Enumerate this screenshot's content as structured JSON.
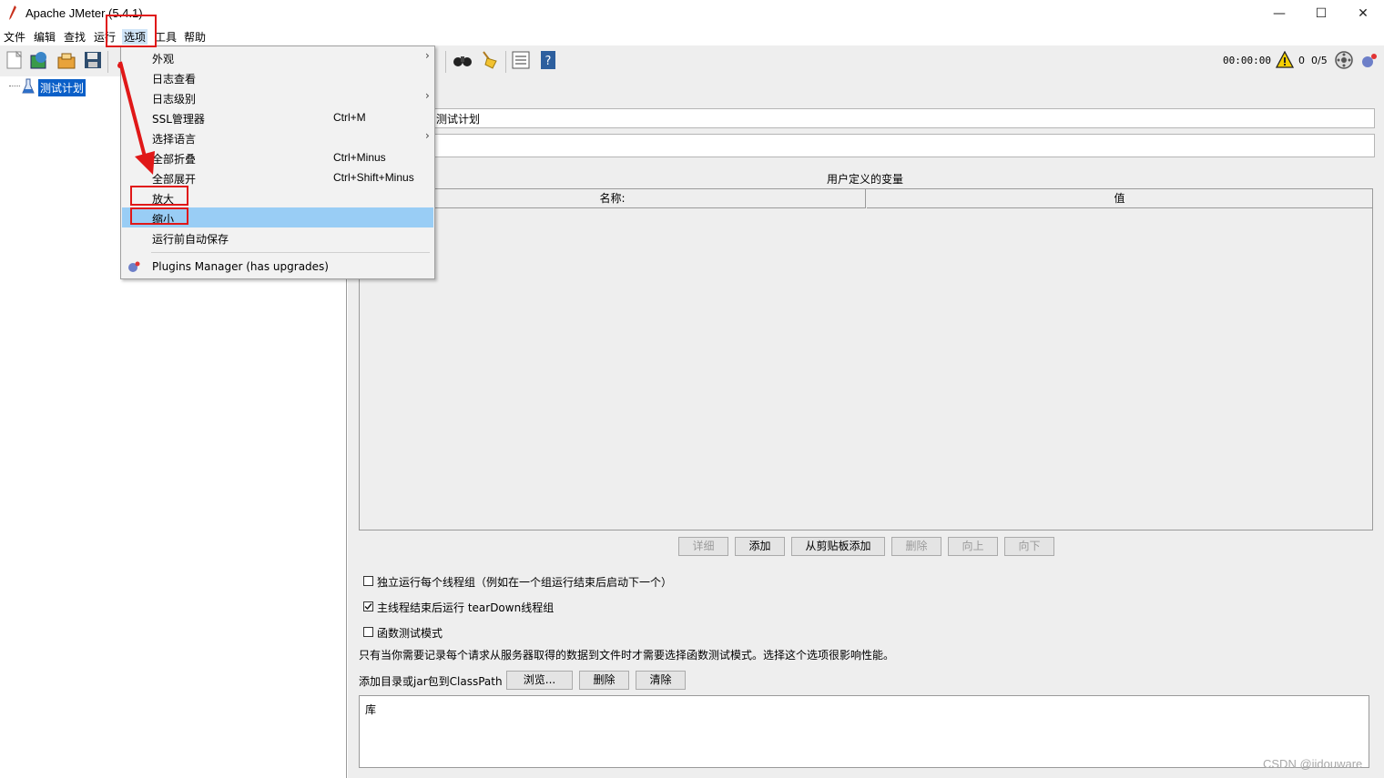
{
  "window": {
    "title": "Apache JMeter (5.4.1)",
    "minimize": "—",
    "maximize": "☐",
    "close": "✕"
  },
  "menubar": [
    "文件",
    "编辑",
    "查找",
    "运行",
    "选项",
    "工具",
    "帮助"
  ],
  "toolbar": {
    "timer": "00:00:00",
    "error_count": "0",
    "threads": "0/5"
  },
  "tree": {
    "root_label": "测试计划"
  },
  "panel": {
    "name_value": "测试计划",
    "vars_title": "用户定义的变量",
    "col_name": "名称:",
    "col_value": "值",
    "buttons": {
      "detail": "详细",
      "add": "添加",
      "add_clipboard": "从剪贴板添加",
      "delete": "删除",
      "up": "向上",
      "down": "向下"
    },
    "options": {
      "serialize": "独立运行每个线程组（例如在一个组运行结束后启动下一个）",
      "teardown": "主线程结束后运行 tearDown线程组",
      "functional": "函数测试模式",
      "functional_note": "只有当你需要记录每个请求从服务器取得的数据到文件时才需要选择函数测试模式。选择这个选项很影响性能。"
    },
    "classpath_label": "添加目录或jar包到ClassPath",
    "classpath_buttons": {
      "browse": "浏览...",
      "delete": "删除",
      "clear": "清除"
    },
    "lib_header": "库"
  },
  "options_menu": {
    "items": [
      {
        "label": "外观",
        "accel": "",
        "submenu": true
      },
      {
        "label": "日志查看",
        "accel": "",
        "submenu": false
      },
      {
        "label": "日志级别",
        "accel": "",
        "submenu": true
      },
      {
        "label": "SSL管理器",
        "accel": "Ctrl+M",
        "submenu": false
      },
      {
        "label": "选择语言",
        "accel": "",
        "submenu": true
      },
      {
        "label": "全部折叠",
        "accel": "Ctrl+Minus",
        "submenu": false
      },
      {
        "label": "全部展开",
        "accel": "Ctrl+Shift+Minus",
        "submenu": false
      },
      {
        "label": "放大",
        "accel": "",
        "submenu": false
      },
      {
        "label": "缩小",
        "accel": "",
        "submenu": false
      },
      {
        "label": "运行前自动保存",
        "accel": "",
        "submenu": false
      }
    ],
    "plugins_label": "Plugins Manager (has upgrades)",
    "submenu_arrow": "›",
    "highlighted_color": "#99cdf5"
  },
  "watermark": "CSDN @iidouware",
  "colors": {
    "annotation_red": "#e01818",
    "selection_blue": "#0a5fc8"
  }
}
